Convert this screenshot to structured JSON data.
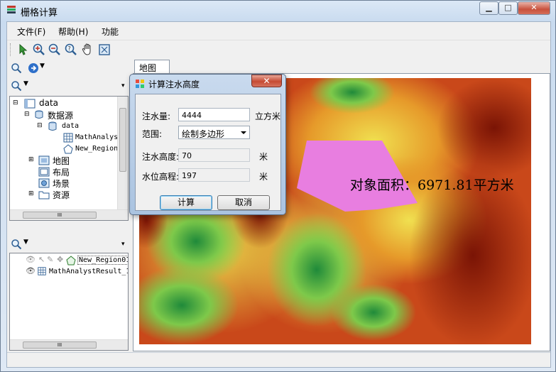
{
  "window": {
    "title": "栅格计算",
    "minimize": "▁",
    "maximize": "□",
    "close": "✕"
  },
  "menu": [
    {
      "label": "文件(F)"
    },
    {
      "label": "帮助(H)"
    },
    {
      "label": "功能"
    }
  ],
  "toolbar": [
    {
      "icon": "select-arrow-icon"
    },
    {
      "icon": "zoom-in-icon"
    },
    {
      "icon": "zoom-out-icon"
    },
    {
      "icon": "zoom-query-icon"
    },
    {
      "icon": "pan-hand-icon"
    },
    {
      "icon": "full-extent-icon"
    }
  ],
  "workspace_tree": {
    "items": [
      {
        "label": "data"
      },
      {
        "label": "数据源"
      },
      {
        "label": "data"
      },
      {
        "label": "MathAnalystResult"
      },
      {
        "label": "New_Region"
      },
      {
        "label": "地图"
      },
      {
        "label": "布局"
      },
      {
        "label": "场景"
      },
      {
        "label": "资源"
      }
    ],
    "hscroll_glyph": "III"
  },
  "layers": {
    "items": [
      {
        "label": "New_Region01"
      },
      {
        "label": "MathAnalystResult_1"
      }
    ],
    "hscroll_glyph": "III"
  },
  "map": {
    "tab_label": "地图",
    "area_label": "对象面积：6971.81平方米",
    "polygon_color": "#e87ee0"
  },
  "dialog": {
    "title": "计算注水高度",
    "close": "✕",
    "water_volume_label": "注水量:",
    "water_volume_value": "4444",
    "water_volume_unit": "立方米",
    "range_label": "范围:",
    "range_value": "绘制多边形",
    "water_height_label": "注水高度:",
    "water_height_value": "70",
    "water_height_unit": "米",
    "water_level_label": "水位高程:",
    "water_level_value": "197",
    "water_level_unit": "米",
    "ok_label": "计算",
    "cancel_label": "取消"
  }
}
